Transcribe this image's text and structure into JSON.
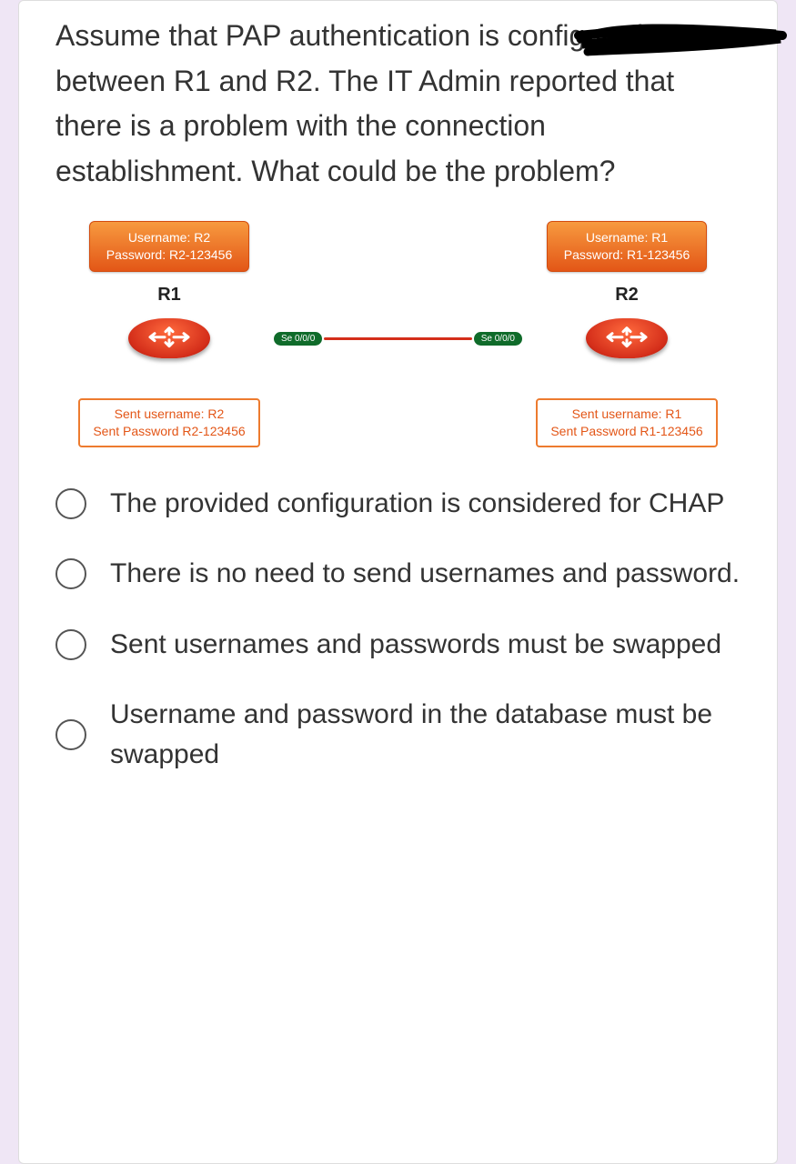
{
  "question": "Assume that PAP authentication is configured between R1 and R2. The IT Admin reported that there is a problem with the connection establishment. What could be the problem?",
  "diagram": {
    "left": {
      "db_user_line": "Username: R2",
      "db_pass_line": "Password: R2-123456",
      "router_label": "R1",
      "iface": "Se 0/0/0",
      "sent_user_line": "Sent username: R2",
      "sent_pass_line": "Sent Password R2-123456"
    },
    "right": {
      "db_user_line": "Username: R1",
      "db_pass_line": "Password: R1-123456",
      "router_label": "R2",
      "iface": "Se 0/0/0",
      "sent_user_line": "Sent username: R1",
      "sent_pass_line": "Sent Password R1-123456"
    }
  },
  "options": [
    "The provided configuration is considered for CHAP",
    "There is no need to send usernames and password.",
    "Sent usernames and passwords must be swapped",
    "Username and password in the database must be swapped"
  ]
}
